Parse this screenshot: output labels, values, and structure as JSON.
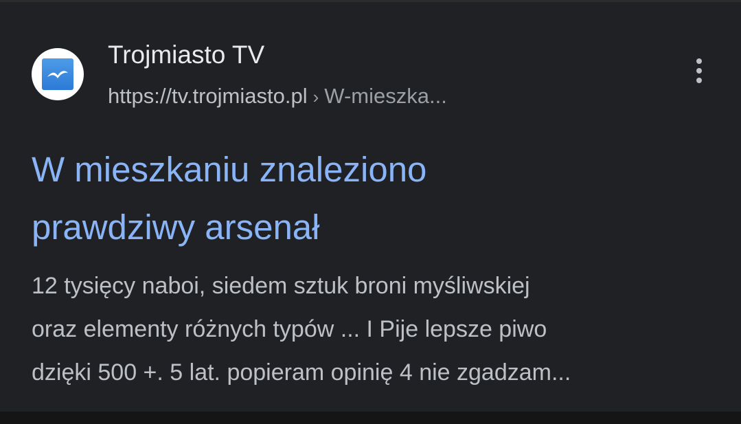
{
  "result": {
    "site_name": "Trojmiasto TV",
    "url_domain": "https://tv.trojmiasto.pl",
    "url_separator": "›",
    "url_path": "W-mieszka...",
    "favicon": "seagull-icon",
    "menu_icon": "more-vert-icon",
    "title_line1": "W mieszkaniu znaleziono",
    "title_line2": "prawdziwy arsenał",
    "snippet_line1": "12 tysięcy naboi, siedem sztuk broni myśliwskiej",
    "snippet_line2": "oraz elementy różnych typów ... I Pije lepsze piwo",
    "snippet_line3": "dzięki 500 +. 5 lat. popieram opinię 4 nie zgadzam..."
  },
  "colors": {
    "background": "#202124",
    "title_link": "#8ab4f8",
    "site_name": "#e8eaed",
    "secondary_text": "#bdc1c6",
    "favicon_blue": "#2b7ad6"
  }
}
